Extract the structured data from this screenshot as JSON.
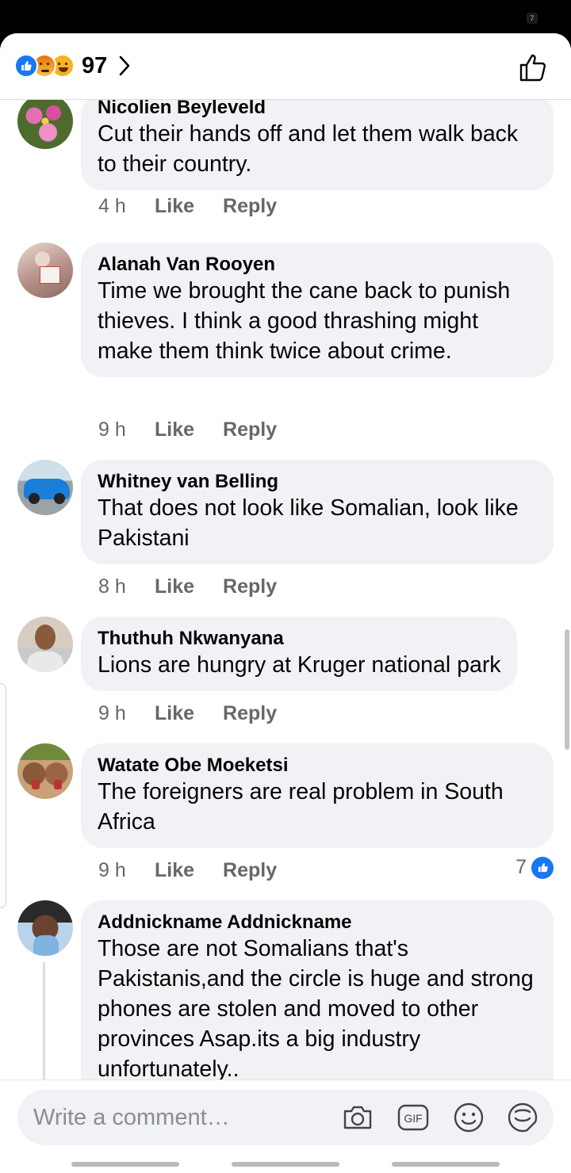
{
  "status_bar": {
    "badge": "7"
  },
  "header": {
    "reaction_icons": [
      "like-reaction-icon",
      "angry-reaction-icon",
      "haha-reaction-icon"
    ],
    "reaction_count": "97"
  },
  "comments": [
    {
      "name": "Nicolien Beyleveld",
      "text": "Cut their hands off and let them walk back to their country.",
      "time": "4 h",
      "like": "Like",
      "reply": "Reply"
    },
    {
      "name": "Alanah Van Rooyen",
      "text": "Time we brought the cane back to punish thieves. I think a good thrashing might make them think twice about crime.",
      "time": "9 h",
      "like": "Like",
      "reply": "Reply"
    },
    {
      "name": "Whitney van Belling",
      "text": "That does not look like Somalian, look like Pakistani",
      "time": "8 h",
      "like": "Like",
      "reply": "Reply"
    },
    {
      "name": "Thuthuh Nkwanyana",
      "text": "Lions are hungry at Kruger national park",
      "time": "9 h",
      "like": "Like",
      "reply": "Reply"
    },
    {
      "name": "Watate Obe Moeketsi",
      "text": "The foreigners are real problem in South Africa",
      "time": "9 h",
      "like": "Like",
      "reply": "Reply",
      "reaction_count": "7"
    },
    {
      "name": "Addnickname Addnickname",
      "text": "Those are not Somalians that's Pakistanis,and the circle is huge and strong phones are stolen and moved to other provinces Asap.its a big industry unfortunately.."
    }
  ],
  "composer": {
    "placeholder": "Write a comment…",
    "icons": [
      "camera-icon",
      "gif-icon",
      "emoji-icon",
      "sticker-icon"
    ]
  },
  "colors": {
    "accent": "#1877f2",
    "bubble": "#f0f2f5",
    "secondary_text": "#65676b"
  }
}
